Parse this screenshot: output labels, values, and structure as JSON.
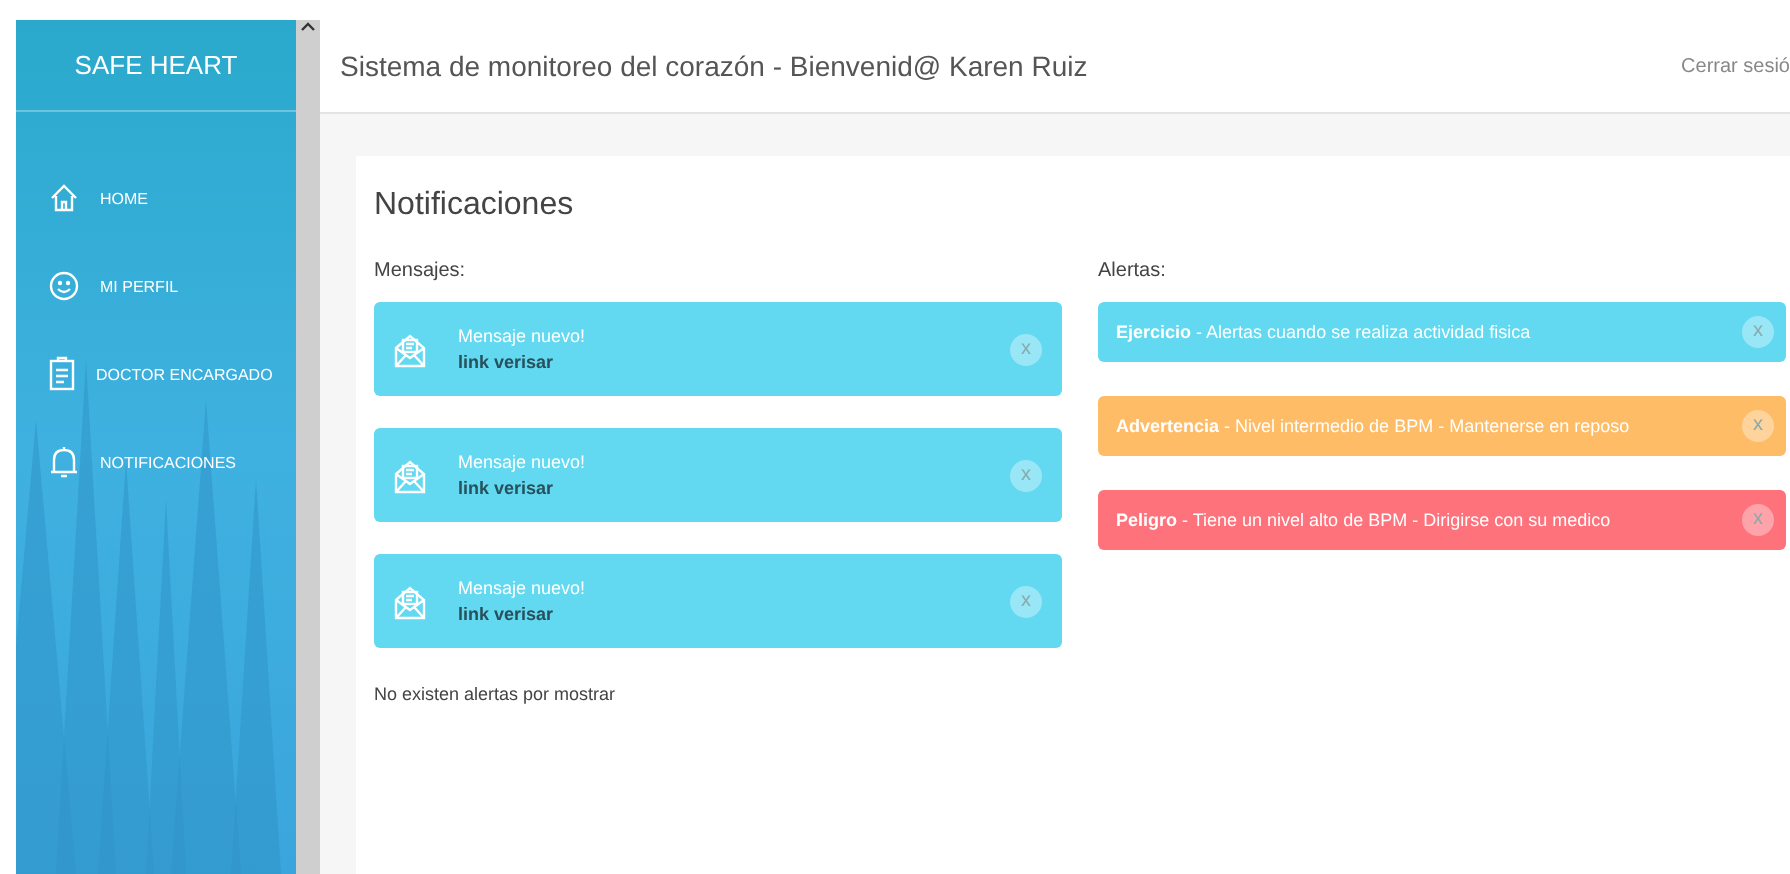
{
  "sidebar": {
    "brand": "SAFE HEART",
    "items": [
      {
        "label": "HOME"
      },
      {
        "label": "MI PERFIL"
      },
      {
        "label": "DOCTOR ENCARGADO"
      },
      {
        "label": "NOTIFICACIONES"
      }
    ]
  },
  "header": {
    "title": "Sistema de monitoreo del corazón - Bienvenid@ Karen Ruiz",
    "logout": "Cerrar sesió"
  },
  "panel": {
    "title": "Notificaciones",
    "messages_label": "Mensajes:",
    "alerts_label": "Alertas:",
    "messages": [
      {
        "title": "Mensaje nuevo!",
        "link": "link verisar",
        "close": "x"
      },
      {
        "title": "Mensaje nuevo!",
        "link": "link verisar",
        "close": "x"
      },
      {
        "title": "Mensaje nuevo!",
        "link": "link verisar",
        "close": "x"
      }
    ],
    "empty_text": "No existen alertas por mostrar",
    "alerts": [
      {
        "kind": "info",
        "text": "**Ejercicio** - Alertas cuando se realiza actividad fisica",
        "close": "x"
      },
      {
        "kind": "warning",
        "text": "**Advertencia** - Nivel intermedio de BPM - Mantenerse en reposo",
        "close": "x"
      },
      {
        "kind": "danger",
        "text": "**Peligro** - Tiene un nivel alto de BPM - Dirigirse con su medico",
        "close": "x"
      }
    ]
  }
}
